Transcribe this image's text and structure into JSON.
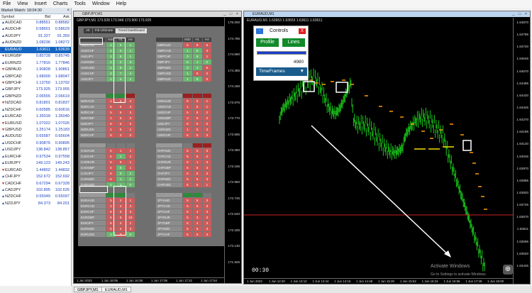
{
  "menu": [
    "File",
    "View",
    "Insert",
    "Charts",
    "Tools",
    "Window",
    "Help"
  ],
  "market_watch": {
    "title": "Market Watch: 18:04:30",
    "headers": {
      "symbol": "Symbol",
      "bid": "Bid",
      "ask": "Ask"
    },
    "rows": [
      {
        "symbol": "AUDCAD",
        "bid": "0.88551",
        "ask": "0.88582",
        "dir": "up"
      },
      {
        "symbol": "AUDCHF",
        "bid": "0.58601",
        "ask": "0.58629",
        "dir": "up"
      },
      {
        "symbol": "AUDJPY",
        "bid": "91.327",
        "ask": "91.359",
        "dir": "up"
      },
      {
        "symbol": "AUDNZD",
        "bid": "1.08236",
        "ask": "1.08272",
        "dir": "up"
      },
      {
        "symbol": "EURAUD",
        "bid": "1.63611",
        "ask": "1.63639",
        "dir": "up",
        "selected": true
      },
      {
        "symbol": "EURGBP",
        "bid": "0.85728",
        "ask": "0.85745",
        "dir": "dn"
      },
      {
        "symbol": "EURNZD",
        "bid": "1.77816",
        "ask": "1.77846",
        "dir": "up"
      },
      {
        "symbol": "GBPAUD",
        "bid": "1.90828",
        "ask": "1.90861",
        "dir": "dn"
      },
      {
        "symbol": "GBPCAD",
        "bid": "1.68000",
        "ask": "1.68047",
        "dir": "up"
      },
      {
        "symbol": "GBPCHF",
        "bid": "1.13750",
        "ask": "1.13792",
        "dir": "dn"
      },
      {
        "symbol": "GBPJPY",
        "bid": "173.925",
        "ask": "173.955",
        "dir": "up"
      },
      {
        "symbol": "GBPNZD",
        "bid": "2.06555",
        "ask": "2.06619",
        "dir": "up"
      },
      {
        "symbol": "NZDCAD",
        "bid": "0.81801",
        "ask": "0.81837",
        "dir": "dn"
      },
      {
        "symbol": "NZDCHF",
        "bid": "0.60585",
        "ask": "0.60616",
        "dir": "up"
      },
      {
        "symbol": "EURCAD",
        "bid": "1.35018",
        "ask": "1.35040",
        "dir": "up"
      },
      {
        "symbol": "EURUSD",
        "bid": "1.07022",
        "ask": "1.07026",
        "dir": "dn"
      },
      {
        "symbol": "GBPUSD",
        "bid": "1.25174",
        "ask": "1.25183",
        "dir": "dn"
      },
      {
        "symbol": "AUDUSD",
        "bid": "0.65587",
        "ask": "0.65604",
        "dir": "up"
      },
      {
        "symbol": "USDCHF",
        "bid": "0.90876",
        "ask": "0.90895",
        "dir": "up"
      },
      {
        "symbol": "USDJPY",
        "bid": "138.842",
        "ask": "138.857",
        "dir": "up"
      },
      {
        "symbol": "EURCHF",
        "bid": "0.97534",
        "ask": "0.97558",
        "dir": "up"
      },
      {
        "symbol": "EURJPY",
        "bid": "149.123",
        "ask": "149.243",
        "dir": "up"
      },
      {
        "symbol": "EURCAD",
        "bid": "1.44802",
        "ask": "1.44832",
        "dir": "dn"
      },
      {
        "symbol": "CHFJPY",
        "bid": "152.672",
        "ask": "152.692",
        "dir": "up"
      },
      {
        "symbol": "CADCHF",
        "bid": "0.67294",
        "ask": "0.67328",
        "dir": "dn"
      },
      {
        "symbol": "CADJPY",
        "bid": "102.895",
        "ask": "102.626",
        "dir": "up"
      },
      {
        "symbol": "NZDCHF",
        "bid": "0.55049",
        "ask": "0.55097",
        "dir": "up"
      },
      {
        "symbol": "NZDJPY",
        "bid": "84.373",
        "ask": "84.201",
        "dir": "up"
      }
    ]
  },
  "chart_left": {
    "title": "GBPJPY,M1",
    "info": "GBPJPY,M1  173.928  173.948  173.900  173.925",
    "prices": [
      "175.000",
      "174.795",
      "174.590",
      "174.385",
      "174.180",
      "173.975",
      "173.770",
      "173.565",
      "173.360",
      "173.155",
      "172.950",
      "172.745",
      "172.540",
      "172.335",
      "172.130",
      "171.925"
    ],
    "times": [
      "1 Jun 2023",
      "1 Jun 16:06",
      "1 Jun 16:38",
      "1 Jun 17:06",
      "1 Jun 17:22",
      "1 Jun 17:54"
    ]
  },
  "dashboard": {
    "tabs": [
      "Alt",
      "Fib/Ultimate",
      "Trend Dashboard",
      "",
      "",
      "",
      "",
      "",
      "",
      "",
      "",
      "",
      "",
      "",
      "",
      "MA"
    ],
    "tab_labels": [
      "Alt",
      "Fib-Ultimate",
      "Trend Dashboard"
    ],
    "tf_headers": [
      "M30",
      "H1",
      "H4"
    ],
    "groups": [
      {
        "name": "AUD",
        "rows": [
          {
            "s": "AUDCAD",
            "v": [
              "1",
              "0",
              "1"
            ],
            "c": [
              "g",
              "g",
              "g"
            ]
          },
          {
            "s": "AUDCHF",
            "v": [
              "1",
              "2",
              "1"
            ],
            "c": [
              "g",
              "g",
              "g"
            ]
          },
          {
            "s": "AUDJPY",
            "v": [
              "1",
              "5",
              "1"
            ],
            "c": [
              "g",
              "g",
              "g"
            ]
          },
          {
            "s": "AUDNZD",
            "v": [
              "1",
              "2",
              "3"
            ],
            "c": [
              "g",
              "g",
              "g"
            ]
          },
          {
            "s": "AUDUSD",
            "v": [
              "1",
              "8",
              "1"
            ],
            "c": [
              "g",
              "g",
              "g"
            ]
          },
          {
            "s": "AUDCHF",
            "v": [
              "3",
              "7",
              "4"
            ],
            "c": [
              "g",
              "g",
              "g"
            ]
          },
          {
            "s": "AUDJPY",
            "v": [
              "1",
              "4",
              "1"
            ],
            "c": [
              "g",
              "g",
              "g"
            ]
          }
        ]
      },
      {
        "name": "GBP",
        "rows": [
          {
            "s": "GBPAUD",
            "v": [
              "5",
              "8",
              "6"
            ],
            "c": [
              "r",
              "r",
              "r"
            ]
          },
          {
            "s": "GBPCAD",
            "v": [
              "1",
              "5",
              "3"
            ],
            "c": [
              "g",
              "g",
              "r"
            ]
          },
          {
            "s": "GBPCHF",
            "v": [
              "3",
              "5",
              "1"
            ],
            "c": [
              "g",
              "g",
              "r"
            ]
          },
          {
            "s": "GBPJPY",
            "v": [
              "5",
              "1",
              "2"
            ],
            "c": [
              "g",
              "g",
              "g"
            ]
          },
          {
            "s": "GBPNZD",
            "v": [
              "3",
              "1",
              "5"
            ],
            "c": [
              "g",
              "g",
              "r"
            ]
          },
          {
            "s": "GBPUSD",
            "v": [
              "1",
              "5",
              "2"
            ],
            "c": [
              "g",
              "r",
              "r"
            ]
          },
          {
            "s": "GBPAUD",
            "v": [
              "1",
              "8",
              "0"
            ],
            "c": [
              "g",
              "g",
              "r"
            ]
          }
        ]
      },
      {
        "name": "NZD",
        "rows": [
          {
            "s": "NZDAUD",
            "v": [
              "1",
              "4",
              "4"
            ],
            "c": [
              "r",
              "r",
              "r"
            ]
          },
          {
            "s": "NZDCAD",
            "v": [
              "5",
              "5",
              "3"
            ],
            "c": [
              "r",
              "r",
              "r"
            ]
          },
          {
            "s": "NZDCHF",
            "v": [
              "5",
              "5",
              "3"
            ],
            "c": [
              "r",
              "r",
              "r"
            ]
          },
          {
            "s": "NZDGBP",
            "v": [
              "1",
              "5",
              "3"
            ],
            "c": [
              "r",
              "r",
              "r"
            ]
          },
          {
            "s": "NZDJPY",
            "v": [
              "6",
              "5",
              "2"
            ],
            "c": [
              "r",
              "r",
              "r"
            ]
          },
          {
            "s": "NZDUSD",
            "v": [
              "1",
              "5",
              "1"
            ],
            "c": [
              "r",
              "r",
              "r"
            ]
          },
          {
            "s": "NZDCHF",
            "v": [
              "5",
              "3",
              "3"
            ],
            "c": [
              "r",
              "r",
              "r"
            ]
          }
        ]
      },
      {
        "name": "USD",
        "rows": [
          {
            "s": "USDAUD",
            "v": [
              "5",
              "5",
              "1"
            ],
            "c": [
              "r",
              "r",
              "r"
            ]
          },
          {
            "s": "USDCAD",
            "v": [
              "1",
              "5",
              "1"
            ],
            "c": [
              "r",
              "r",
              "r"
            ]
          },
          {
            "s": "USDCHF",
            "v": [
              "5",
              "5",
              "2"
            ],
            "c": [
              "r",
              "r",
              "r"
            ]
          },
          {
            "s": "USDGBP",
            "v": [
              "3",
              "5",
              "3"
            ],
            "c": [
              "r",
              "r",
              "r"
            ]
          },
          {
            "s": "USDJPY",
            "v": [
              "5",
              "5",
              "0"
            ],
            "c": [
              "r",
              "r",
              "r"
            ]
          },
          {
            "s": "USDNZD",
            "v": [
              "1",
              "5",
              "2"
            ],
            "c": [
              "r",
              "r",
              "r"
            ]
          },
          {
            "s": "USDCHF",
            "v": [
              "5",
              "5",
              "3"
            ],
            "c": [
              "r",
              "r",
              "r"
            ]
          }
        ]
      },
      {
        "name": "CAD",
        "rows": [
          {
            "s": "CADAUD",
            "v": [
              "5",
              "1",
              "1"
            ],
            "c": [
              "r",
              "r",
              "r"
            ]
          },
          {
            "s": "CADCHF",
            "v": [
              "5",
              "1",
              "1"
            ],
            "c": [
              "r",
              "g",
              "r"
            ]
          },
          {
            "s": "CADEUR",
            "v": [
              "5",
              "5",
              "1"
            ],
            "c": [
              "r",
              "r",
              "r"
            ]
          },
          {
            "s": "CADGBP",
            "v": [
              "5",
              "5",
              "1"
            ],
            "c": [
              "r",
              "g",
              "r"
            ]
          },
          {
            "s": "CADJPY",
            "v": [
              "5",
              "3",
              "1"
            ],
            "c": [
              "r",
              "g",
              "g"
            ]
          },
          {
            "s": "CADNZD",
            "v": [
              "5",
              "1",
              "1"
            ],
            "c": [
              "r",
              "g",
              "g"
            ]
          },
          {
            "s": "CADUSD",
            "v": [
              "1",
              "1",
              "0"
            ],
            "c": [
              "g",
              "g",
              "g"
            ]
          }
        ]
      },
      {
        "name": "CHF",
        "rows": [
          {
            "s": "CHFAUD",
            "v": [
              "5",
              "5",
              "3"
            ],
            "c": [
              "r",
              "r",
              "r"
            ]
          },
          {
            "s": "CHFCAD",
            "v": [
              "5",
              "5",
              "2"
            ],
            "c": [
              "r",
              "r",
              "r"
            ]
          },
          {
            "s": "CHFEUR",
            "v": [
              "5",
              "1",
              "3"
            ],
            "c": [
              "r",
              "r",
              "r"
            ]
          },
          {
            "s": "CHFGBP",
            "v": [
              "5",
              "5",
              "3"
            ],
            "c": [
              "r",
              "r",
              "r"
            ]
          },
          {
            "s": "CHFJPY",
            "v": [
              "5",
              "5",
              "3"
            ],
            "c": [
              "r",
              "r",
              "r"
            ]
          },
          {
            "s": "CHFNZD",
            "v": [
              "5",
              "5",
              "3"
            ],
            "c": [
              "r",
              "r",
              "r"
            ]
          },
          {
            "s": "CHFUSD",
            "v": [
              "5",
              "5",
              "1"
            ],
            "c": [
              "r",
              "r",
              "r"
            ]
          }
        ]
      },
      {
        "name": "EUR",
        "rows": [
          {
            "s": "EURAUD",
            "v": [
              "5",
              "2",
              "1"
            ],
            "c": [
              "r",
              "r",
              "r"
            ]
          },
          {
            "s": "EURCAD",
            "v": [
              "1",
              "4",
              "4"
            ],
            "c": [
              "r",
              "r",
              "r"
            ]
          },
          {
            "s": "EURCHF",
            "v": [
              "5",
              "5",
              "3"
            ],
            "c": [
              "r",
              "r",
              "r"
            ]
          },
          {
            "s": "EURGBP",
            "v": [
              "5",
              "5",
              "10"
            ],
            "c": [
              "r",
              "r",
              "r"
            ]
          },
          {
            "s": "EURJPY",
            "v": [
              "5",
              "4",
              "1"
            ],
            "c": [
              "r",
              "r",
              "r"
            ]
          },
          {
            "s": "EURNZD",
            "v": [
              "5",
              "4",
              "3"
            ],
            "c": [
              "r",
              "r",
              "r"
            ]
          },
          {
            "s": "EURUSD",
            "v": [
              "1",
              "0",
              "0"
            ],
            "c": [
              "g",
              "r",
              "g"
            ]
          }
        ]
      },
      {
        "name": "JPY",
        "rows": [
          {
            "s": "JPYAUD",
            "v": [
              "5",
              "5",
              "3"
            ],
            "c": [
              "r",
              "r",
              "r"
            ]
          },
          {
            "s": "JPYCAD",
            "v": [
              "5",
              "5",
              "3"
            ],
            "c": [
              "r",
              "r",
              "r"
            ]
          },
          {
            "s": "JPYCHF",
            "v": [
              "5",
              "4",
              "3"
            ],
            "c": [
              "r",
              "r",
              "r"
            ]
          },
          {
            "s": "JPYEUR",
            "v": [
              "5",
              "3",
              "3"
            ],
            "c": [
              "r",
              "r",
              "r"
            ]
          },
          {
            "s": "JPYGBP",
            "v": [
              "5",
              "4",
              "3"
            ],
            "c": [
              "r",
              "r",
              "r"
            ]
          },
          {
            "s": "JPYNZD",
            "v": [
              "5",
              "5",
              "3"
            ],
            "c": [
              "r",
              "r",
              "r"
            ]
          },
          {
            "s": "JPYCHF",
            "v": [
              "5",
              "5",
              "3"
            ],
            "c": [
              "r",
              "r",
              "r"
            ]
          }
        ]
      }
    ]
  },
  "chart_right": {
    "title": "EURAUD,M1",
    "info": "EURAUD,M1  1.63653  1.63653  1.63611  1.63611",
    "prices": [
      "1.64870",
      "1.64795",
      "1.64720",
      "1.64645",
      "1.64570",
      "1.64495",
      "1.64420",
      "1.64345",
      "1.64270",
      "1.64195",
      "1.64120",
      "1.64045",
      "1.63970",
      "1.63895",
      "1.63820",
      "1.63745",
      "1.63670",
      "1.63611",
      "1.63595",
      "1.63520",
      "1.63445"
    ],
    "times": [
      "1 Jun 2023",
      "1 Jun 12:40",
      "1 Jun 13:12",
      "1 Jun 13:44",
      "1 Jun 14:16",
      "1 Jun 14:48",
      "1 Jun 15:20",
      "1 Jun 15:52",
      "1 Jun 16:24",
      "1 Jun 16:56",
      "1 Jun 17:28",
      "1 Jun 18:00"
    ],
    "countdown": "00:30"
  },
  "controls": {
    "title": "Controls",
    "min_label": "-",
    "close_label": "X",
    "profile_label": "Profile",
    "lines_label": "Lines",
    "progress": 1.0,
    "value": "4980",
    "timeframes_label": "TimeFrames"
  },
  "bottom_tabs": [
    "GBPJPY,M1",
    "EURAUD,M1"
  ],
  "watermark": {
    "line1": "Activate Windows",
    "line2": "Go to Settings to activate Windows."
  }
}
